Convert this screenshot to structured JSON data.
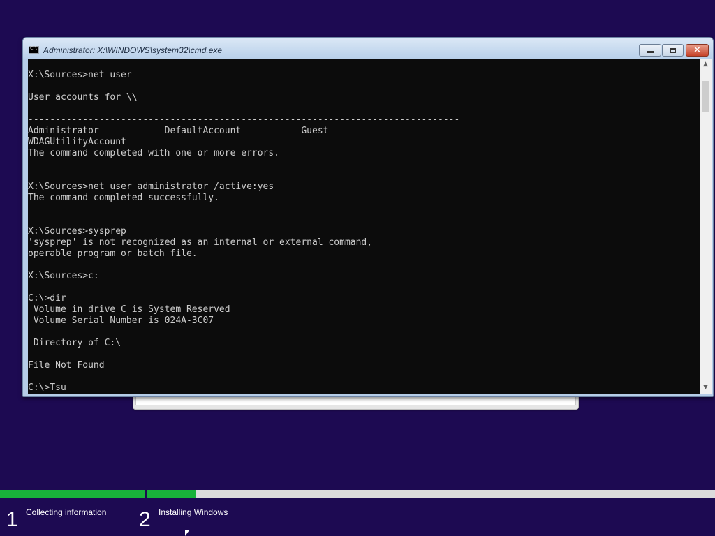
{
  "window": {
    "title": "Administrator: X:\\WINDOWS\\system32\\cmd.exe",
    "icon_label": "C:\\",
    "minimize_glyph": "minimize",
    "maximize_glyph": "maximize",
    "close_glyph": "✕"
  },
  "console": {
    "text": "X:\\Sources>net user\n\nUser accounts for \\\\\n\n-------------------------------------------------------------------------------\nAdministrator            DefaultAccount           Guest\nWDAGUtilityAccount\nThe command completed with one or more errors.\n\n\nX:\\Sources>net user administrator /active:yes\nThe command completed successfully.\n\n\nX:\\Sources>sysprep\n'sysprep' is not recognized as an internal or external command,\noperable program or batch file.\n\nX:\\Sources>c:\n\nC:\\>dir\n Volume in drive C is System Reserved\n Volume Serial Number is 024A-3C07\n\n Directory of C:\\\n\nFile Not Found\n\nC:\\>Tsu"
  },
  "scrollbar": {
    "up_arrow": "▲",
    "down_arrow": "▼"
  },
  "setup_progress": {
    "steps": [
      {
        "number": "1",
        "label": "Collecting information",
        "progress": 1.0
      },
      {
        "number": "2",
        "label": "Installing Windows",
        "progress": 0.086
      }
    ],
    "accent_color": "#19b23a",
    "background_color": "#1d0a52"
  }
}
